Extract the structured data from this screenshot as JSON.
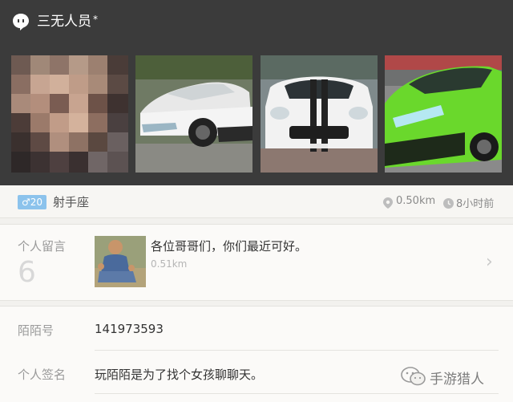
{
  "header": {
    "title": "三无人员",
    "star": "*",
    "icon": "chat-bubble-icon"
  },
  "gallery": {
    "photos": [
      {
        "name": "blurred-photo"
      },
      {
        "name": "white-concept-car-photo"
      },
      {
        "name": "white-ferrari-photo"
      },
      {
        "name": "green-lamborghini-photo"
      }
    ]
  },
  "profile": {
    "gender_age": "♂20",
    "constellation": "射手座",
    "distance": "0.50km",
    "time_ago": "8小时前"
  },
  "messages": {
    "label": "个人留言",
    "count": "6",
    "latest_text": "各位哥哥们，你们最近可好。",
    "latest_distance": "0.51km"
  },
  "info": {
    "id_label": "陌陌号",
    "id_value": "141973593",
    "sign_label": "个人签名",
    "sign_value": "玩陌陌是为了找个女孩聊聊天。"
  },
  "watermark": {
    "text": "手游猎人"
  },
  "colors": {
    "header_bg": "#3b3b3b",
    "badge_male": "#8cc3ec",
    "lamborghini_green": "#6ad82c"
  }
}
